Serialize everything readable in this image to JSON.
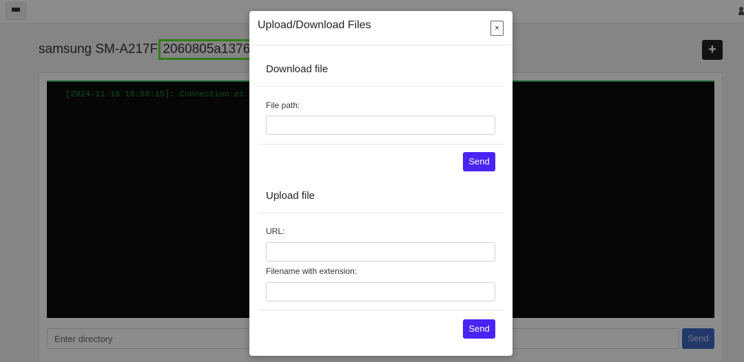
{
  "topbar": {
    "menu_icon": "hamburger-icon",
    "user_icon": "user-icon"
  },
  "device": {
    "name": "samsung SM-A217F",
    "id": "2060805a1376"
  },
  "add_button": {
    "label": "+",
    "icon": "plus-icon"
  },
  "terminal": {
    "line": "[2024-11-18 16:58:15]: Connection es"
  },
  "directory": {
    "placeholder": "Enter directory",
    "send_label": "Send"
  },
  "modal": {
    "title": "Upload/Download Files",
    "close_label": "×",
    "download": {
      "title": "Download file",
      "path_label": "File path:",
      "path_value": "",
      "send_label": "Send"
    },
    "upload": {
      "title": "Upload file",
      "url_label": "URL:",
      "url_value": "",
      "filename_label": "Filename with extension:",
      "filename_value": "",
      "send_label": "Send"
    }
  },
  "colors": {
    "highlight": "#58e62a",
    "primary": "#4a23f5",
    "terminal_bg": "#0b0b0b",
    "terminal_text": "#1c8c3b",
    "secondary_send": "#4066c4"
  }
}
